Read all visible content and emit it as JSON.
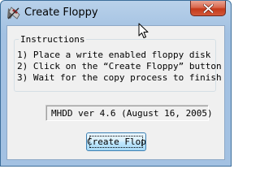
{
  "window": {
    "title": "Create Floppy",
    "icon": "create-floppy-app-icon",
    "close_icon": "close-icon"
  },
  "instructions": {
    "title": "Instructions",
    "lines": [
      "1) Place a write enabled floppy disk",
      "2) Click on the “Create Floppy” button",
      "3) Wait for the copy process to finish"
    ]
  },
  "version": {
    "text": "MHDD ver 4.6 (August 16, 2005)"
  },
  "actions": {
    "create_label": "Create Floppy"
  },
  "colors": {
    "title_bar": "#b9d1ea",
    "client": "#f0f0f0",
    "close_button": "#c5391a",
    "button_border": "#3c7fb1"
  },
  "cursor": {
    "icon": "arrow-cursor-icon"
  }
}
